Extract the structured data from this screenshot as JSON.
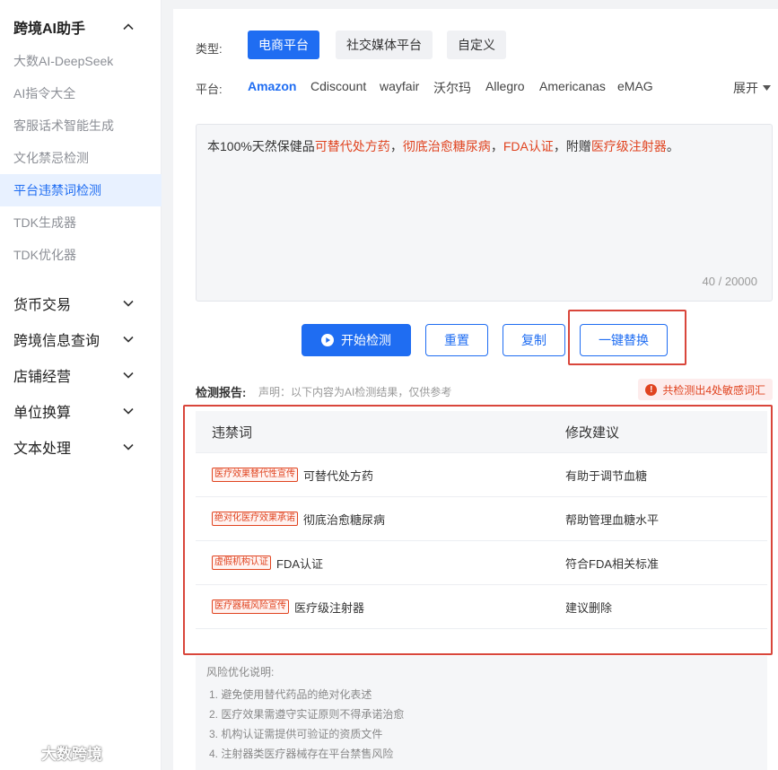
{
  "sidebar": {
    "group_ai": "跨境AI助手",
    "items": [
      "大数AI-DeepSeek",
      "AI指令大全",
      "客服话术智能生成",
      "文化禁忌检测",
      "平台违禁词检测",
      "TDK生成器",
      "TDK优化器"
    ],
    "active_item": "平台违禁词检测",
    "groups": [
      "货币交易",
      "跨境信息查询",
      "店铺经营",
      "单位换算",
      "文本处理"
    ],
    "watermark": "大数跨境"
  },
  "filters": {
    "type_label": "类型:",
    "types": [
      "电商平台",
      "社交媒体平台",
      "自定义"
    ],
    "selected_type": "电商平台",
    "platform_label": "平台:",
    "platforms": [
      "Amazon",
      "Cdiscount",
      "wayfair",
      "沃尔玛",
      "Allegro",
      "Americanas",
      "eMAG"
    ],
    "selected_platform": "Amazon",
    "expand_label": "展开"
  },
  "input": {
    "segments": [
      {
        "text": "本100%天然保健品",
        "hl": false
      },
      {
        "text": "可替代处方药",
        "hl": true
      },
      {
        "text": "，",
        "hl": false
      },
      {
        "text": "彻底治愈糖尿病",
        "hl": true
      },
      {
        "text": "，",
        "hl": false
      },
      {
        "text": "FDA认证",
        "hl": true
      },
      {
        "text": "，附赠",
        "hl": false
      },
      {
        "text": "医疗级注射器",
        "hl": true
      },
      {
        "text": "。",
        "hl": false
      }
    ],
    "count": "40 / 20000"
  },
  "actions": {
    "start": "开始检测",
    "reset": "重置",
    "copy": "复制",
    "replace": "一键替换"
  },
  "report": {
    "title": "检测报告:",
    "note": "声明：以下内容为AI检测结果，仅供参考",
    "alert": "共检测出4处敏感词汇",
    "col_word": "违禁词",
    "col_suggest": "修改建议",
    "rows": [
      {
        "tag": "医疗效果替代性宣传",
        "word": "可替代处方药",
        "suggest": "有助于调节血糖"
      },
      {
        "tag": "绝对化医疗效果承诺",
        "word": "彻底治愈糖尿病",
        "suggest": "帮助管理血糖水平"
      },
      {
        "tag": "虚假机构认证",
        "word": "FDA认证",
        "suggest": "符合FDA相关标准"
      },
      {
        "tag": "医疗器械风险宣传",
        "word": "医疗级注射器",
        "suggest": "建议删除"
      }
    ]
  },
  "risk": {
    "title": "风险优化说明:",
    "items": [
      "1. 避免使用替代药品的绝对化表述",
      "2. 医疗效果需遵守实证原则不得承诺治愈",
      "3. 机构认证需提供可验证的资质文件",
      "4. 注射器类医疗器械存在平台禁售风险"
    ]
  },
  "colors": {
    "accent": "#1f6df2",
    "danger": "#e0431f",
    "highlight_box": "#d9463b"
  }
}
